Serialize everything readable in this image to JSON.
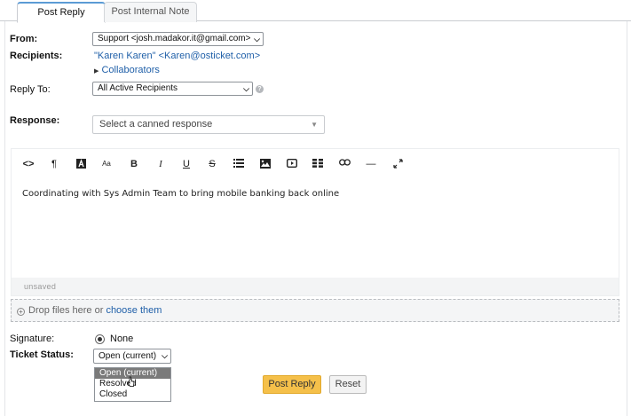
{
  "tabs": [
    {
      "label": "Post Reply",
      "active": true
    },
    {
      "label": "Post Internal Note",
      "active": false
    }
  ],
  "form": {
    "from_label": "From:",
    "from_value": "Support <josh.madakor.it@gmail.com>",
    "recipients_label": "Recipients:",
    "recipients_value": "\"Karen Karen\" <Karen@osticket.com>",
    "collaborators_label": "Collaborators",
    "reply_to_label": "Reply To:",
    "reply_to_value": "All Active Recipients",
    "response_label": "Response:",
    "canned_placeholder": "Select a canned response"
  },
  "editor": {
    "toolbar_icons": [
      "code-view-icon",
      "paragraph-icon",
      "font-color-icon",
      "font-size-icon",
      "bold-icon",
      "italic-icon",
      "underline-icon",
      "strikethrough-icon",
      "list-icon",
      "image-icon",
      "video-icon",
      "table-icon",
      "link-icon",
      "horizontal-rule-icon",
      "fullscreen-icon"
    ],
    "toolbar_glyphs": {
      "code": "<>",
      "paragraph": "¶",
      "font_size": "Aa",
      "bold": "B",
      "italic": "I",
      "underline": "U",
      "strike": "S",
      "hr": "—"
    },
    "content": "Coordinating with Sys Admin Team to bring mobile banking back online",
    "status": "unsaved"
  },
  "dropzone": {
    "text": "Drop files here or ",
    "link": "choose them"
  },
  "signature": {
    "label": "Signature:",
    "value": "None"
  },
  "ticket_status": {
    "label": "Ticket Status:",
    "value": "Open (current)",
    "options": [
      "Open (current)",
      "Resolved",
      "Closed"
    ]
  },
  "buttons": {
    "post_reply": "Post Reply",
    "reset": "Reset"
  },
  "colors": {
    "primary_button": "#f5c04a",
    "link": "#1f5fa8",
    "tab_accent": "#5b9bd5"
  }
}
